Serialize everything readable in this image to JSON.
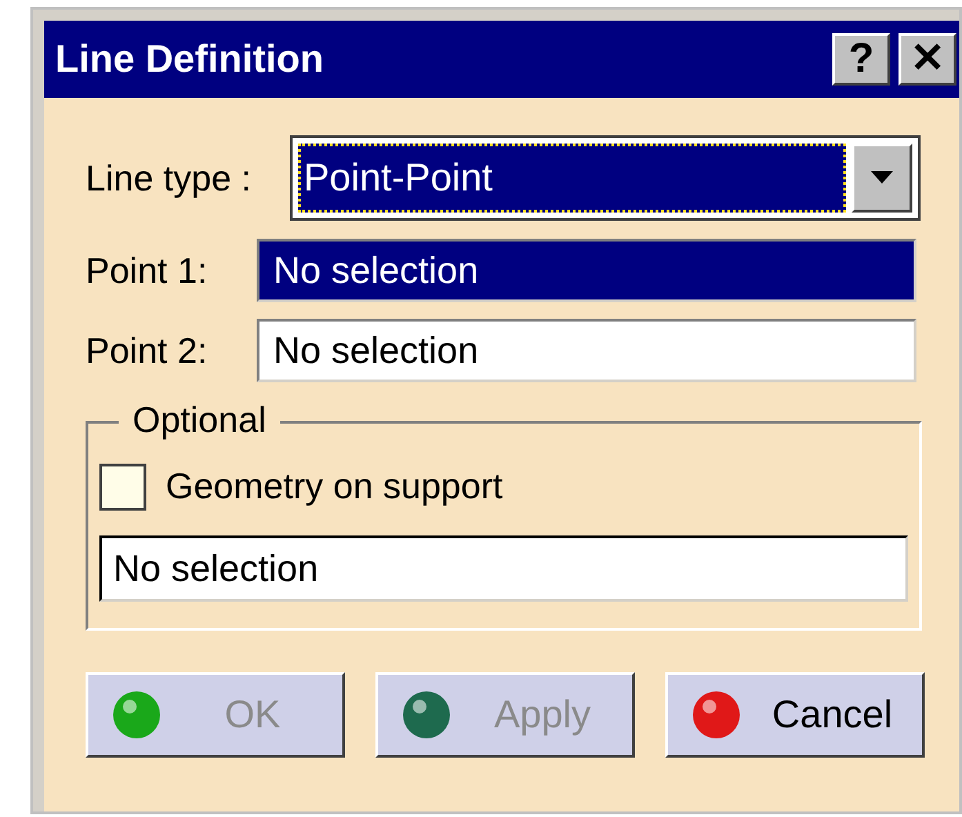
{
  "window": {
    "title": "Line Definition"
  },
  "title_buttons": [
    {
      "label": "?"
    },
    {
      "label": "✕"
    }
  ],
  "line_type": {
    "label": "Line type :",
    "value": "Point-Point"
  },
  "points": [
    {
      "label": "Point 1:",
      "value": "No selection",
      "selected": true
    },
    {
      "label": "Point 2:",
      "value": "No selection",
      "selected": false
    }
  ],
  "optional": {
    "title": "Optional",
    "checkbox": {
      "label": "Geometry on support",
      "checked": false
    },
    "field": {
      "value": "No selection"
    }
  },
  "buttons": [
    {
      "label": "OK",
      "disabled": true,
      "color": "#1aa81a"
    },
    {
      "label": "Apply",
      "disabled": true,
      "color": "#1e6a4e"
    },
    {
      "label": "Cancel",
      "disabled": false,
      "color": "#e01818"
    }
  ]
}
